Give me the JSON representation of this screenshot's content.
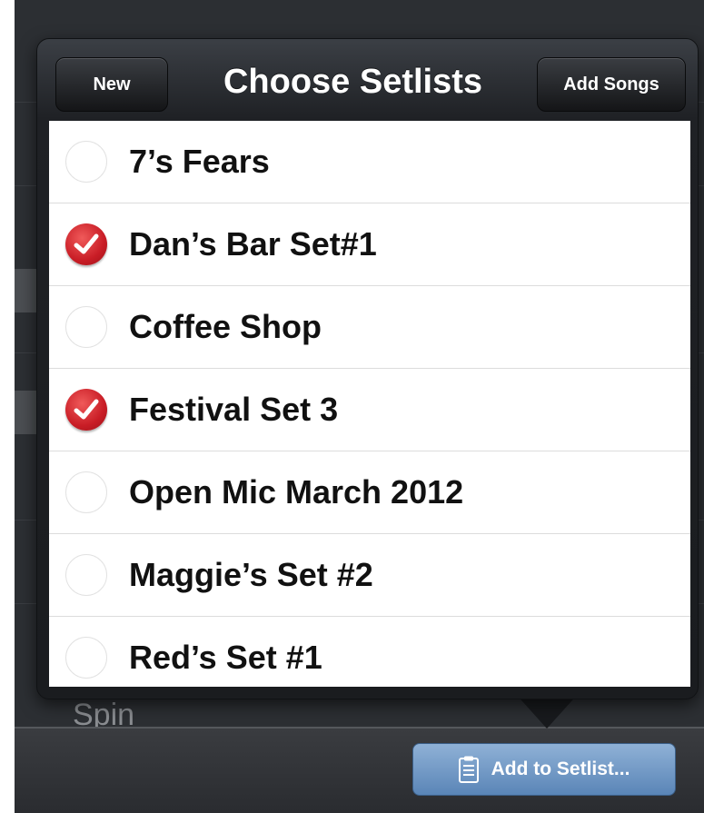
{
  "background": {
    "peek_text": "Spin"
  },
  "toolbar": {
    "add_to_setlist_label": "Add to Setlist..."
  },
  "popover": {
    "title": "Choose Setlists",
    "new_label": "New",
    "add_songs_label": "Add Songs",
    "setlists": [
      {
        "name": "7’s Fears",
        "checked": false
      },
      {
        "name": "Dan’s Bar Set#1",
        "checked": true
      },
      {
        "name": "Coffee Shop",
        "checked": false
      },
      {
        "name": "Festival Set 3",
        "checked": true
      },
      {
        "name": "Open Mic March 2012",
        "checked": false
      },
      {
        "name": "Maggie’s Set #2",
        "checked": false
      },
      {
        "name": "Red’s Set #1",
        "checked": false
      }
    ]
  },
  "icons": {
    "checkmark": "checkmark-icon",
    "radio": "radio-empty-icon",
    "clipboard": "clipboard-icon"
  },
  "colors": {
    "check_red": "#c91d26",
    "button_blue": "#5a85b7",
    "header_dark": "#1f2125"
  }
}
